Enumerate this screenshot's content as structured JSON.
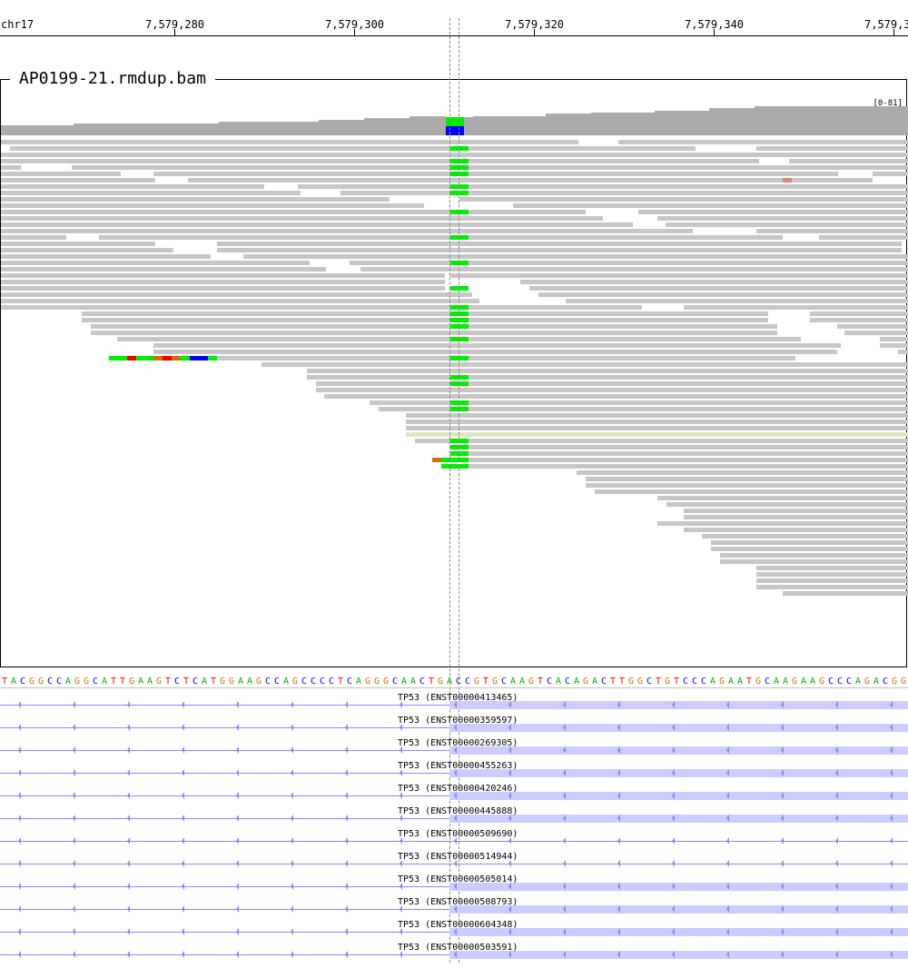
{
  "ruler": {
    "chrom": "chr17",
    "ticks": [
      "7,579,280",
      "7,579,300",
      "7,579,320",
      "7,579,340",
      "7,579,3"
    ]
  },
  "track": {
    "name": "AP0199-21.rmdup.bam",
    "range": "[0-81]"
  },
  "colors": {
    "read": "#c7c7c7",
    "coverage": "#ababab",
    "mismatch_green": "#00ee00",
    "mismatch_blue": "#0000ff",
    "mismatch_red": "#ee0000",
    "mismatch_orange": "#d17105",
    "transcript": "#8888ff",
    "exon": "#ccccff"
  },
  "reference_sequence": "TACGGCCAGGCATTGAAGTCTCATGGAAGCCAGCCCCTCAGGGCAACTGACCGTGCAAGTCACAGACTTGGCTGTCCCAGAATGCAAGAAGCCCAGACGGAA",
  "transcripts": [
    {
      "label": "TP53 (ENST00000413465)",
      "exon": true
    },
    {
      "label": "TP53 (ENST00000359597)",
      "exon": true
    },
    {
      "label": "TP53 (ENST00000269305)",
      "exon": true
    },
    {
      "label": "TP53 (ENST00000455263)",
      "exon": true
    },
    {
      "label": "TP53 (ENST00000420246)",
      "exon": true
    },
    {
      "label": "TP53 (ENST00000445888)",
      "exon": true
    },
    {
      "label": "TP53 (ENST00000509690)",
      "exon": false
    },
    {
      "label": "TP53 (ENST00000514944)",
      "exon": false
    },
    {
      "label": "TP53 (ENST00000505014)",
      "exon": true
    },
    {
      "label": "TP53 (ENST00000508793)",
      "exon": true
    },
    {
      "label": "TP53 (ENST00000604348)",
      "exon": true
    },
    {
      "label": "TP53 (ENST00000503591)",
      "exon": true
    }
  ]
}
